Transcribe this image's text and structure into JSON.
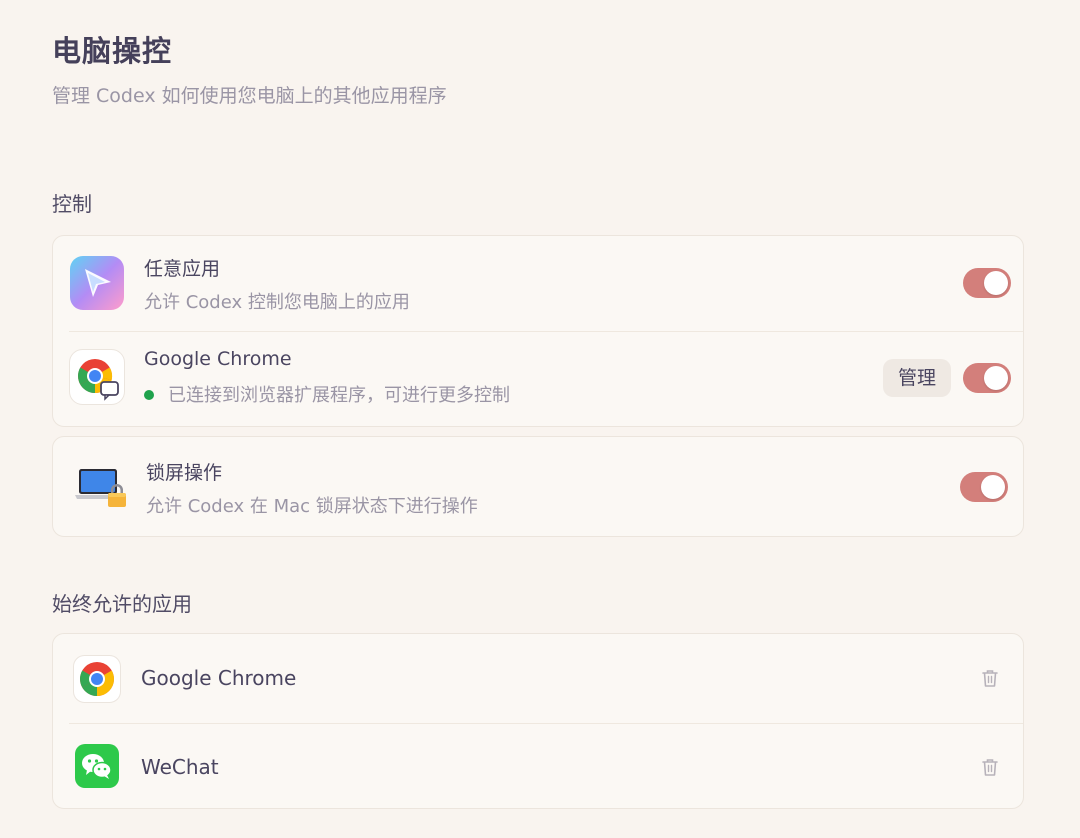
{
  "header": {
    "title": "电脑操控",
    "subtitle": "管理 Codex 如何使用您电脑上的其他应用程序"
  },
  "control_section": {
    "title": "控制",
    "items": [
      {
        "title": "任意应用",
        "description": "允许 Codex 控制您电脑上的应用",
        "icon": "codex-pointer-icon",
        "enabled": true
      },
      {
        "title": "Google Chrome",
        "description": "已连接到浏览器扩展程序，可进行更多控制",
        "icon": "chrome-extension-icon",
        "status_color": "#1fa24c",
        "manage_label": "管理",
        "enabled": true
      }
    ]
  },
  "lock_section": {
    "title": "锁屏操作",
    "description": "允许 Codex 在 Mac 锁屏状态下进行操作",
    "icon": "laptop-lock-icon",
    "enabled": true
  },
  "allowed_section": {
    "title": "始终允许的应用",
    "apps": [
      {
        "name": "Google Chrome",
        "icon": "chrome-icon"
      },
      {
        "name": "WeChat",
        "icon": "wechat-icon"
      }
    ]
  },
  "colors": {
    "background": "#f9f4ef",
    "toggle_on": "#d37f7b",
    "status_connected": "#1fa24c"
  }
}
